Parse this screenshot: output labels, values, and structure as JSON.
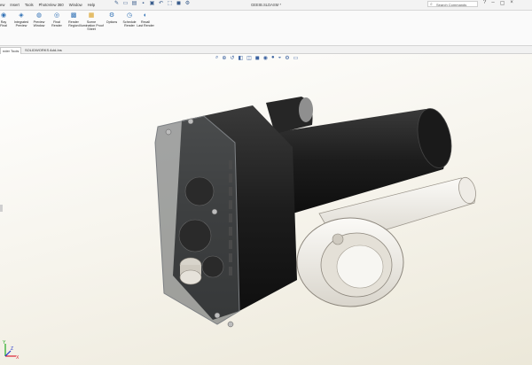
{
  "menubar": {
    "menus": [
      "ew",
      "Insert",
      "Tools",
      "PhotoView 360",
      "Window",
      "Help"
    ],
    "quick_icons": [
      "new-icon",
      "open-icon",
      "save-icon",
      "print-icon",
      "undo-icon",
      "select-icon",
      "rebuild-icon",
      "options-icon"
    ],
    "doc_title": "GEEIB.SLDASM *",
    "search_label": "Search Commands",
    "window_icons": [
      "help-icon",
      "minimize-icon",
      "restore-icon",
      "close-icon"
    ]
  },
  "ribbon": {
    "items": [
      {
        "label": "Ray",
        "sub": "Final",
        "icon": "ray-trace-icon"
      },
      {
        "label": "Integrated",
        "sub": "Preview",
        "icon": "integrated-preview-icon"
      },
      {
        "label": "Preview",
        "sub": "Window",
        "icon": "preview-window-icon"
      },
      {
        "label": "Final",
        "sub": "Render",
        "icon": "final-render-icon"
      },
      {
        "label": "Render",
        "sub": "Region",
        "icon": "render-region-icon"
      },
      {
        "label": "Scene",
        "sub": "Illumination Proof Sheet",
        "icon": "scene-illumination-icon"
      },
      {
        "label": "Options",
        "sub": "",
        "icon": "options-icon"
      },
      {
        "label": "Schedule",
        "sub": "Render",
        "icon": "schedule-render-icon"
      },
      {
        "label": "Recall",
        "sub": "Last Render",
        "icon": "recall-render-icon"
      }
    ]
  },
  "tabs": [
    "nder Tools",
    "SOLIDWORKS Add-Ins"
  ],
  "heads_up_icons": [
    "zoom-fit-icon",
    "zoom-area-icon",
    "previous-view-icon",
    "section-view-icon",
    "view-orientation-icon",
    "display-style-icon",
    "hide-show-icon",
    "edit-appearance-icon",
    "apply-scene-icon",
    "view-settings-icon",
    "monitor-icon"
  ],
  "triad": {
    "x": "X",
    "y": "Y",
    "z": "Z"
  }
}
